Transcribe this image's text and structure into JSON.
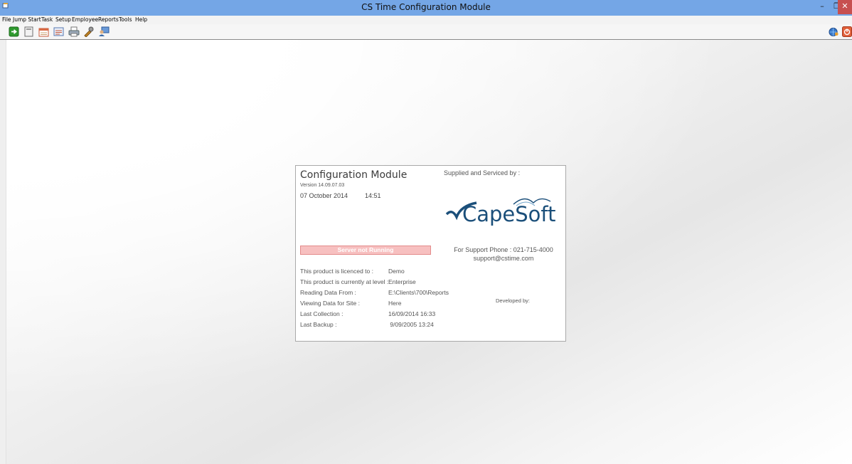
{
  "window": {
    "title": "CS Time Configuration Module",
    "minimize": "–",
    "maximize": "❐",
    "close": "✕"
  },
  "menu": [
    "File",
    "Jump Start",
    "Task",
    "Setup",
    "Employee",
    "Reports",
    "Tools",
    "Help"
  ],
  "toolbar": {
    "left_icons": [
      "exit-icon",
      "document-icon",
      "calendar-icon",
      "report-icon",
      "printer-icon",
      "tools-icon",
      "user-computer-icon"
    ],
    "right_icons": [
      "globe-user-icon",
      "power-off-icon"
    ]
  },
  "panel": {
    "title": "Configuration Module",
    "version": "Version 14.09.07.03",
    "date": "07 October 2014",
    "time": "14:51",
    "supplied_by": "Supplied and Serviced by :",
    "logo_text": "CapeSoft",
    "server_status": "Server not Running",
    "support_phone": "For Support Phone : 021-715-4000",
    "support_email": "support@cstime.com",
    "developed_by": "Developed by:",
    "info": [
      {
        "label": "This product is licenced to :",
        "value": "Demo"
      },
      {
        "label": "This product is currently at level :",
        "value": "Enterprise"
      },
      {
        "label": "Reading Data From :",
        "value": "E:\\Clients\\700\\Reports"
      },
      {
        "label": "Viewing Data for Site :",
        "value": "Here"
      },
      {
        "label": "Last Collection :",
        "value": "16/09/2014 16:33"
      },
      {
        "label": "Last Backup :",
        "value": " 9/09/2005 13:24"
      }
    ]
  },
  "colors": {
    "titlebar": "#74a6e6",
    "close_button": "#c75050",
    "logo_blue": "#1b4f7a",
    "server_status_bg": "#f7c0c0"
  }
}
